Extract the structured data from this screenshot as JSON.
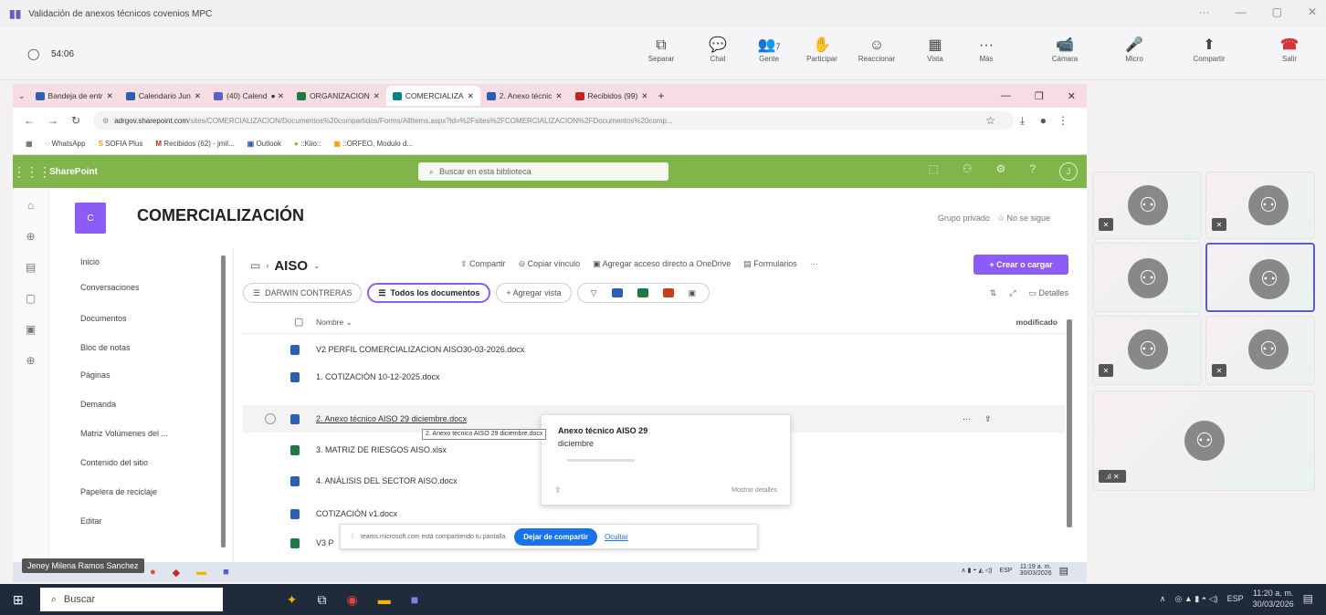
{
  "titlebar": {
    "title": "Validación de anexos técnicos covenios MPC",
    "controls": [
      "···",
      "—",
      "▢",
      "✕"
    ]
  },
  "teams": {
    "timer": "54:06",
    "buttons": [
      {
        "label": "Separar",
        "icon": "⧉"
      },
      {
        "label": "Chat",
        "icon": "💬"
      },
      {
        "label": "Gente",
        "icon": "👥",
        "count": "7"
      },
      {
        "label": "Participar",
        "icon": "✋"
      },
      {
        "label": "Reaccionar",
        "icon": "☺"
      },
      {
        "label": "Vista",
        "icon": "▦"
      },
      {
        "label": "Más",
        "icon": "···"
      },
      {
        "label": "Cámara",
        "icon": "📹"
      },
      {
        "label": "Micro",
        "icon": "🎤"
      },
      {
        "label": "Compartir",
        "icon": "⬆"
      },
      {
        "label": "Salir",
        "icon": "☎"
      }
    ]
  },
  "browser": {
    "tabs": [
      {
        "label": "Bandeja de entr",
        "color": "#2b5fb4"
      },
      {
        "label": "Calendario Jun",
        "color": "#2b5fb4"
      },
      {
        "label": "(40) Calend",
        "color": "#5b5fc7"
      },
      {
        "label": "ORGANIZACION",
        "color": "#1d7a45"
      },
      {
        "label": "COMERCIALIZA",
        "color": "#038387"
      },
      {
        "label": "2. Anexo técnic",
        "color": "#2b5fb4"
      },
      {
        "label": "Recibidos (99)",
        "color": "#c5221f"
      }
    ],
    "url_host": "adrgov.sharepoint.com",
    "url_path": "/sites/COMERCIALIZACION/Documentos%20compartidos/Forms/AllItems.aspx?id=%2Fsites%2FCOMERCIALIZACION%2FDocumentos%20comp...",
    "bookmarks": [
      "WhatsApp",
      "SOFIA Plus",
      "Recibidos (62) - jmil...",
      "Outlook",
      "::Kiio::",
      "::ORFEO, Modulo d..."
    ]
  },
  "sharepoint": {
    "app": "SharePoint",
    "search_placeholder": "Buscar en esta biblioteca",
    "site_logo": "C",
    "site_title": "COMERCIALIZACIÓN",
    "group": "Grupo privado",
    "follow": "☆ No se sigue",
    "nav": [
      "Inicio",
      "Conversaciones",
      "Documentos",
      "Bloc de notas",
      "Páginas",
      "Demanda",
      "Matriz Volúmenes del ...",
      "Contenido del sitio",
      "Papelera de reciclaje",
      "Editar"
    ],
    "breadcrumb": "AISO",
    "commands": [
      "Compartir",
      "Copiar vínculo",
      "Agregar acceso directo a OneDrive",
      "Formularios",
      "···"
    ],
    "create": "+ Crear o cargar",
    "views": {
      "person": "DARWIN CONTRERAS",
      "all": "Todos los documentos",
      "add": "+ Agregar vista",
      "details": "Detalles"
    },
    "columns": {
      "name": "Nombre",
      "modified": "modificado"
    },
    "files": [
      {
        "name": "V2 PERFIL COMERCIALIZACION AISO30-03-2026.docx",
        "type": "w"
      },
      {
        "name": "1. COTIZACIÓN 10-12-2025.docx",
        "type": "w"
      },
      {
        "name": "2. Anexo técnico AISO 29 diciembre.docx",
        "type": "w"
      },
      {
        "name": "3. MATRIZ DE RIESGOS AISO.xlsx",
        "type": "x"
      },
      {
        "name": "4. ANÁLISIS DEL SECTOR AISO.docx",
        "type": "w"
      },
      {
        "name": "COTIZACIÓN v1.docx",
        "type": "w"
      },
      {
        "name": "V3 P",
        "type": "x"
      }
    ],
    "tooltip": "2. Anexo técnico AISO 29 diciembre.docx",
    "card": {
      "title": "Anexo técnico AISO 29",
      "subtitle": "diciembre",
      "action": "Mostrar detalles"
    },
    "share_bar": {
      "text": "teams.microsoft.com está compartiendo tu pantalla.",
      "stop": "Dejar de compartir",
      "hide": "Ocultar"
    }
  },
  "inner_taskbar": {
    "presenter": "Jeney Milena Ramos Sanchez",
    "lang": "ESP",
    "time": "11:19 a. m.",
    "date": "30/03/2026"
  },
  "gallery": {
    "count": 7
  },
  "taskbar": {
    "search": "Buscar",
    "lang": "ESP",
    "time": "11:20 a. m.",
    "date": "30/03/2026"
  }
}
